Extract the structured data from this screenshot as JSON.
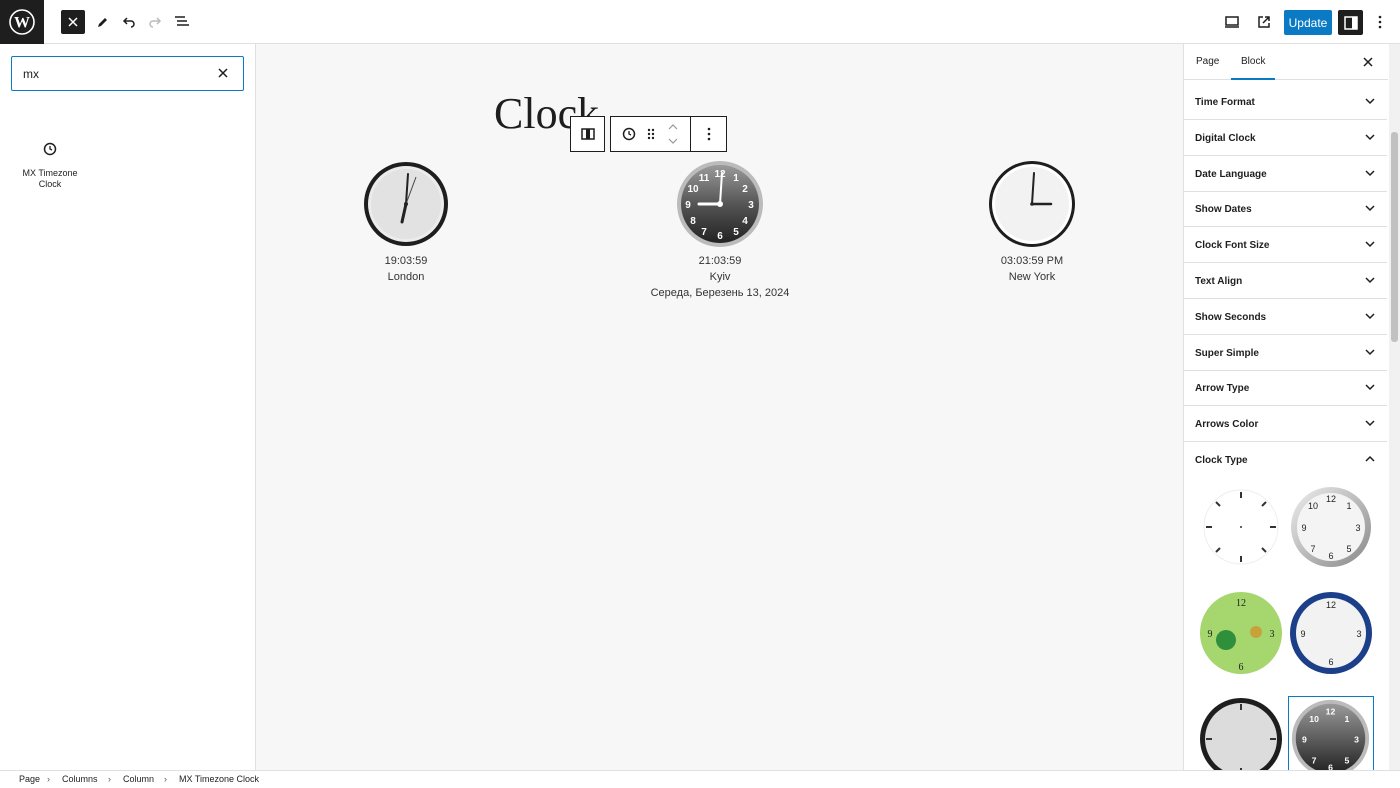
{
  "header": {
    "update_label": "Update"
  },
  "inserter": {
    "search_value": "mx",
    "result_label": "MX Timezone Clock"
  },
  "canvas": {
    "page_title": "Clock",
    "clocks": [
      {
        "time": "19:03:59",
        "city": "London",
        "date": ""
      },
      {
        "time": "21:03:59",
        "city": "Kyiv",
        "date": "Середа, Березень 13, 2024"
      },
      {
        "time": "03:03:59 PM",
        "city": "New York",
        "date": ""
      }
    ]
  },
  "sidebar": {
    "tabs": [
      "Page",
      "Block"
    ],
    "active_tab": "Block",
    "panels": [
      "Time Format",
      "Digital Clock",
      "Date Language",
      "Show Dates",
      "Clock Font Size",
      "Text Align",
      "Show Seconds",
      "Super Simple",
      "Arrow Type",
      "Arrows Color",
      "Clock Type"
    ],
    "expanded_panel": "Clock Type"
  },
  "breadcrumb": [
    "Page",
    "Columns",
    "Column",
    "MX Timezone Clock"
  ],
  "colors": {
    "accent": "#0a7ac4",
    "dark": "#1e1e1e"
  }
}
